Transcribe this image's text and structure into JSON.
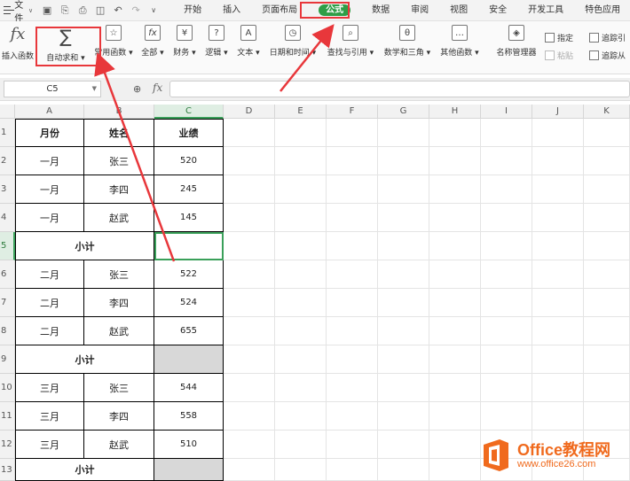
{
  "menubar": {
    "file_label": "文件",
    "tabs": [
      "开始",
      "插入",
      "页面布局",
      "公式",
      "数据",
      "审阅",
      "视图",
      "安全",
      "开发工具",
      "特色应用"
    ],
    "active_tab": "公式"
  },
  "ribbon": {
    "insert_function": "插入函数",
    "autosum": "自动求和",
    "common_functions": "常用函数",
    "all": "全部",
    "finance": "财务",
    "logic": "逻辑",
    "text": "文本",
    "datetime": "日期和时间",
    "lookup": "查找与引用",
    "math": "数学和三角",
    "other": "其他函数",
    "name_manager": "名称管理器",
    "assign": "指定",
    "paste": "粘贴",
    "trace_precedents": "追踪引",
    "trace_dependents": "追踪从"
  },
  "formula_bar": {
    "name_box": "C5",
    "fx_label": "fx",
    "formula": ""
  },
  "columns": [
    "A",
    "B",
    "C",
    "D",
    "E",
    "F",
    "G",
    "H",
    "I",
    "J",
    "K"
  ],
  "rows": [
    "1",
    "2",
    "3",
    "4",
    "5",
    "6",
    "7",
    "8",
    "9",
    "10",
    "11",
    "12",
    "13"
  ],
  "table": {
    "headers": [
      "月份",
      "姓名",
      "业绩"
    ],
    "data": [
      [
        "一月",
        "张三",
        "520"
      ],
      [
        "一月",
        "李四",
        "245"
      ],
      [
        "一月",
        "赵武",
        "145"
      ],
      [
        "小计",
        "",
        ""
      ],
      [
        "二月",
        "张三",
        "522"
      ],
      [
        "二月",
        "李四",
        "524"
      ],
      [
        "二月",
        "赵武",
        "655"
      ],
      [
        "小计",
        "",
        ""
      ],
      [
        "三月",
        "张三",
        "544"
      ],
      [
        "三月",
        "李四",
        "558"
      ],
      [
        "三月",
        "赵武",
        "510"
      ],
      [
        "小计",
        "",
        ""
      ]
    ]
  },
  "selected_cell": "C5",
  "watermark": {
    "title": "Office教程网",
    "url": "www.office26.com"
  },
  "colors": {
    "accent_green": "#2f9e47",
    "annotation_red": "#e8373b",
    "watermark_orange": "#f06a1d"
  }
}
